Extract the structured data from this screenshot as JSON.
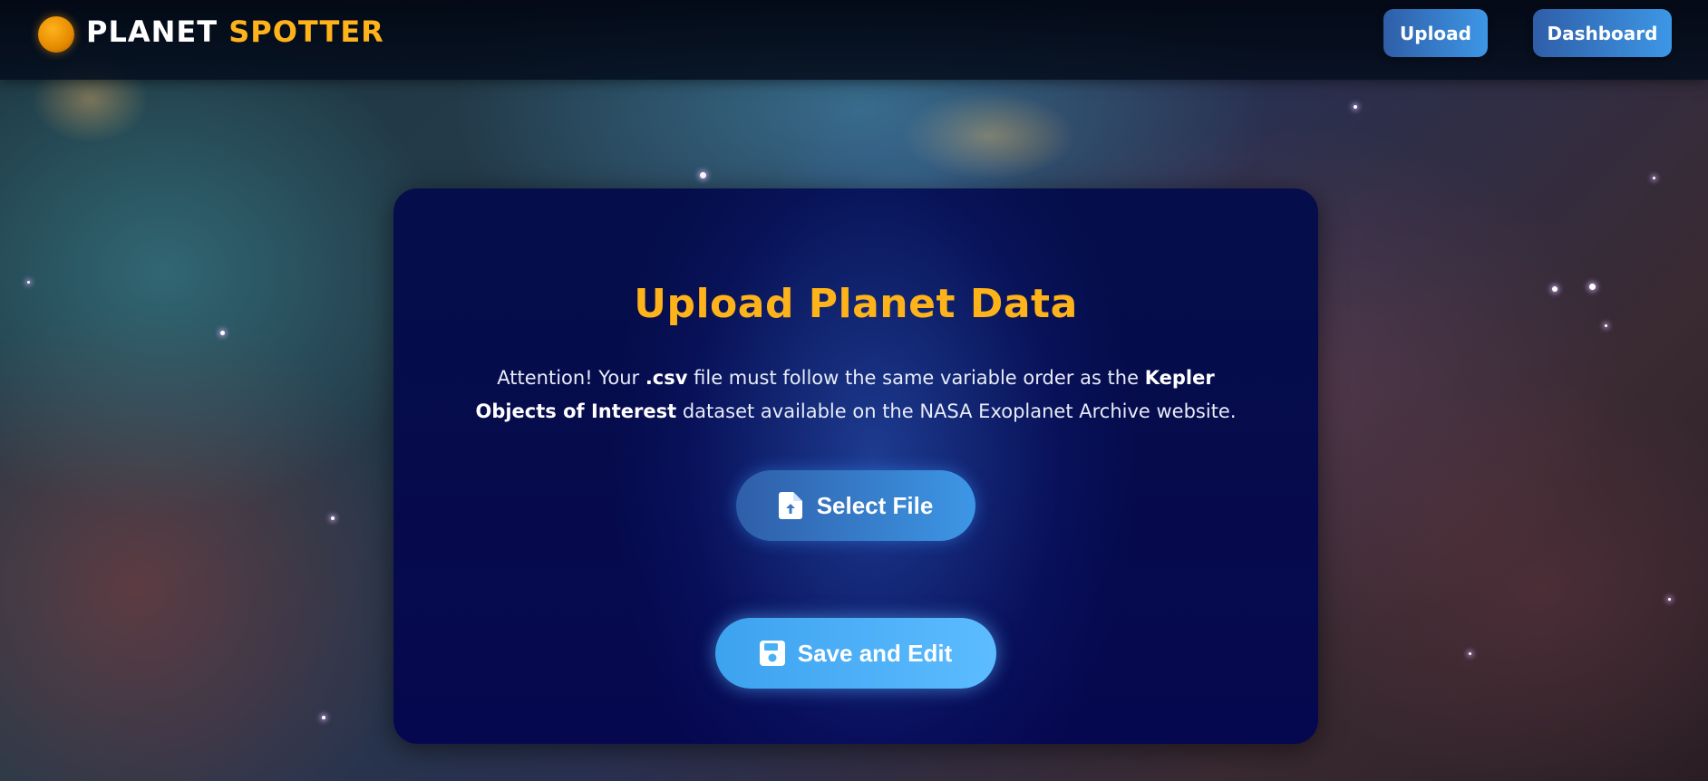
{
  "header": {
    "logo_word1": "PLANET",
    "logo_word2": "SPOTTER",
    "nav": {
      "upload_label": "Upload",
      "dashboard_label": "Dashboard"
    }
  },
  "card": {
    "title": "Upload Planet Data",
    "notice": {
      "part1": "Attention! Your ",
      "bold1": ".csv",
      "part2": " file must follow the same variable order as the ",
      "bold2": "Kepler Objects of Interest",
      "part3": " dataset available on the NASA Exoplanet Archive website."
    },
    "select_file_label": "Select File",
    "save_edit_label": "Save and Edit"
  },
  "icons": {
    "logo": "planet-icon",
    "select_file": "file-upload-icon",
    "save_edit": "floppy-disk-icon"
  },
  "colors": {
    "accent": "#ffb31a",
    "button_blue": "#3d97e6",
    "button_light_blue": "#5cbcff",
    "card_bg": "#06084f"
  }
}
